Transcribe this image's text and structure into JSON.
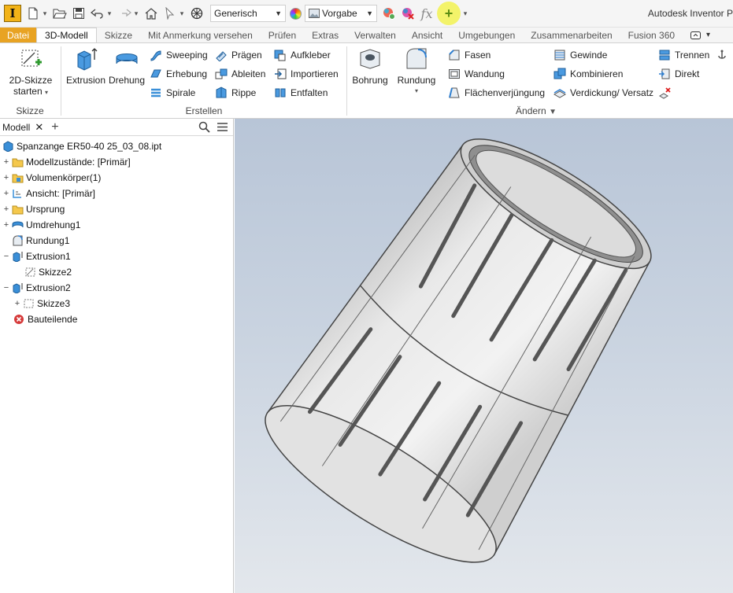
{
  "app": {
    "logo_letter": "I",
    "title": "Autodesk Inventor P"
  },
  "quick_access": {
    "appearance_select": "Generisch",
    "material_select": "Vorgabe",
    "fx_label": "fx"
  },
  "tabs": [
    {
      "label": "Datei"
    },
    {
      "label": "3D-Modell"
    },
    {
      "label": "Skizze"
    },
    {
      "label": "Mit Anmerkung versehen"
    },
    {
      "label": "Prüfen"
    },
    {
      "label": "Extras"
    },
    {
      "label": "Verwalten"
    },
    {
      "label": "Ansicht"
    },
    {
      "label": "Umgebungen"
    },
    {
      "label": "Zusammenarbeiten"
    },
    {
      "label": "Fusion 360"
    }
  ],
  "ribbon": {
    "skizze": {
      "start_sketch_line1": "2D-Skizze",
      "start_sketch_line2": "starten",
      "group_label": "Skizze"
    },
    "erstellen": {
      "extrusion": "Extrusion",
      "drehung": "Drehung",
      "sweeping": "Sweeping",
      "erhebung": "Erhebung",
      "spirale": "Spirale",
      "praegen": "Prägen",
      "ableiten": "Ableiten",
      "rippe": "Rippe",
      "aufkleber": "Aufkleber",
      "importieren": "Importieren",
      "entfalten": "Entfalten",
      "group_label": "Erstellen"
    },
    "aendern": {
      "bohrung": "Bohrung",
      "rundung": "Rundung",
      "fasen": "Fasen",
      "wandung": "Wandung",
      "flaechenverjuengung": "Flächenverjüngung",
      "gewinde": "Gewinde",
      "kombinieren": "Kombinieren",
      "verdickung": "Verdickung/ Versatz",
      "trennen": "Trennen",
      "direkt": "Direkt",
      "group_label": "Ändern"
    }
  },
  "browser": {
    "tab_label": "Modell",
    "tree": [
      {
        "label": "Spanzange ER50-40 25_03_08.ipt"
      },
      {
        "label": "Modellzustände: [Primär]"
      },
      {
        "label": "Volumenkörper(1)"
      },
      {
        "label": "Ansicht: [Primär]"
      },
      {
        "label": "Ursprung"
      },
      {
        "label": "Umdrehung1"
      },
      {
        "label": "Rundung1"
      },
      {
        "label": "Extrusion1"
      },
      {
        "label": "Skizze2"
      },
      {
        "label": "Extrusion2"
      },
      {
        "label": "Skizze3"
      },
      {
        "label": "Bauteilende"
      }
    ]
  },
  "colors": {
    "file_tab": "#e8a323",
    "part_blue": "#3a8fd8",
    "viewport_top": "#b8c5d7",
    "viewport_bottom": "#e3e7ec",
    "highlight": "#f3f36a"
  }
}
